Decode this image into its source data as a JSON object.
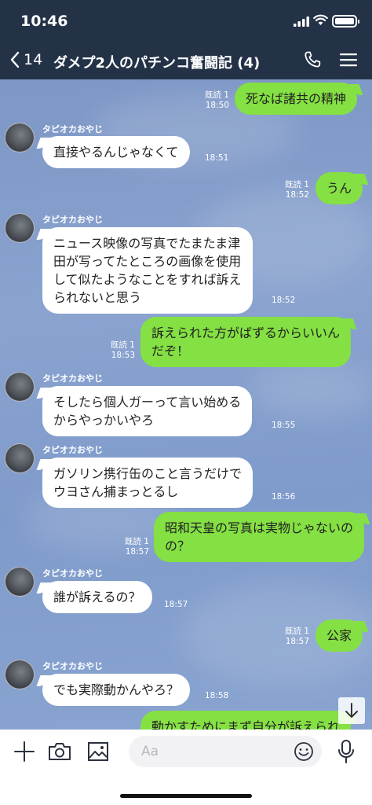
{
  "status_bar": {
    "time": "10:46"
  },
  "header": {
    "back_count": "14",
    "title": "ダメプ2人のパチンコ奮闘記 (4)"
  },
  "sender_name": "タピオカおやじ",
  "messages": [
    {
      "dir": "out",
      "text": "死なば諸共の精神",
      "read": "既読 1",
      "time": "18:50"
    },
    {
      "dir": "in",
      "text": "直接やるんじゃなくて",
      "time": "18:51"
    },
    {
      "dir": "out",
      "text": "うん",
      "read": "既読 1",
      "time": "18:52"
    },
    {
      "dir": "in",
      "lines": [
        "ニュース映像の写真でたまたま津",
        "田が写ってたところの画像を使用",
        "して似たようなことをすれば訴え",
        "られないと思う"
      ],
      "time": "18:52"
    },
    {
      "dir": "out",
      "lines": [
        "訴えられた方がばずるからいいん",
        "だぞ！"
      ],
      "read": "既読 1",
      "time": "18:53"
    },
    {
      "dir": "in",
      "lines": [
        "そしたら個人ガーって言い始める",
        "からやっかいやろ"
      ],
      "time": "18:55"
    },
    {
      "dir": "in",
      "lines": [
        "ガソリン携行缶のこと言うだけで",
        "ウヨさん捕まっとるし"
      ],
      "time": "18:56"
    },
    {
      "dir": "out",
      "lines": [
        "昭和天皇の写真は実物じゃないの",
        "の？"
      ],
      "read": "既読 1",
      "time": "18:57"
    },
    {
      "dir": "in",
      "text": "誰が訴えるの？",
      "time": "18:57"
    },
    {
      "dir": "out",
      "text": "公家",
      "read": "既読 1",
      "time": "18:57"
    },
    {
      "dir": "in",
      "text": "でも実際動かんやろ？",
      "time": "18:58"
    },
    {
      "dir": "out",
      "text": "動かすためにまず自分が訴えられ"
    }
  ],
  "input": {
    "placeholder": "Aa"
  },
  "colors": {
    "header_bg": "#243247",
    "outgoing": "#84e043",
    "incoming": "#ffffff",
    "chat_bg": "#7f9bcb"
  },
  "icons": [
    "back-chevron-icon",
    "phone-icon",
    "menu-icon",
    "plus-icon",
    "camera-icon",
    "image-icon",
    "emoji-icon",
    "mic-icon",
    "scroll-down-icon"
  ]
}
